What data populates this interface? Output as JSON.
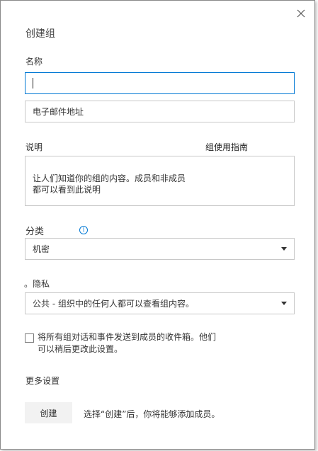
{
  "dialog": {
    "title": "创建组",
    "close_icon": "close-icon"
  },
  "name": {
    "label": "名称",
    "value": ""
  },
  "email": {
    "placeholder": "电子邮件地址"
  },
  "description": {
    "label": "说明",
    "guide_link": "组使用指南",
    "placeholder": "让人们知道你的组的内容。成员和非成员\n都可以看到此说明"
  },
  "classification": {
    "label": "分类",
    "info_icon": "info-icon",
    "selected": "机密"
  },
  "privacy": {
    "label": "。隐私",
    "selected": "公共 - 组织中的任何人都可以查看组内容。"
  },
  "subscribe": {
    "checked": false,
    "text": "将所有组对话和事件发送到成员的收件箱。他们\n可以稍后更改此设置。"
  },
  "more_settings": "更多设置",
  "create": {
    "button_label": "创建",
    "hint": "选择“创建”后，你将能够添加成员。"
  }
}
